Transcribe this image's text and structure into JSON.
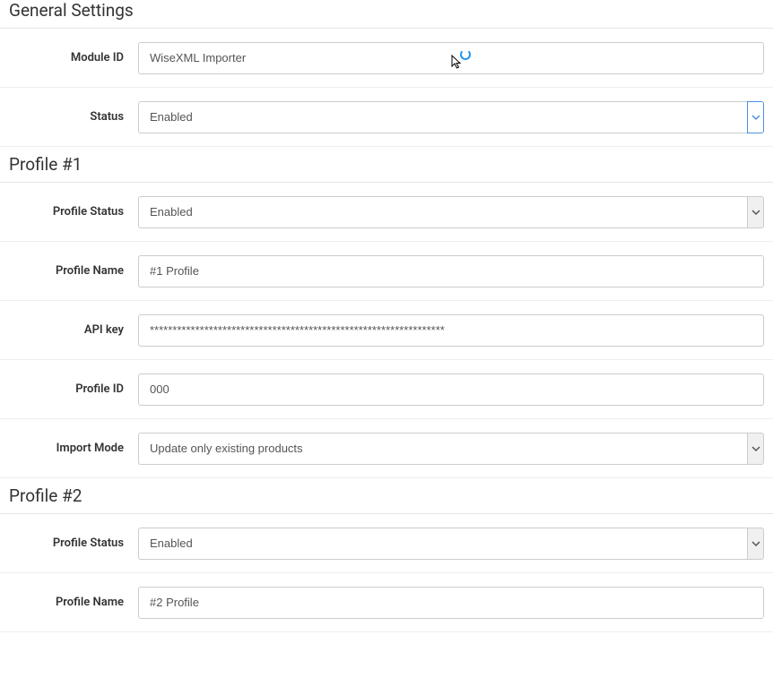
{
  "general": {
    "heading": "General Settings",
    "module_id_label": "Module ID",
    "module_id_value": "WiseXML Importer",
    "status_label": "Status",
    "status_value": "Enabled"
  },
  "profile1": {
    "heading": "Profile #1",
    "status_label": "Profile Status",
    "status_value": "Enabled",
    "name_label": "Profile Name",
    "name_value": "#1 Profile",
    "api_key_label": "API key",
    "api_key_value": "*****************************************************************",
    "id_label": "Profile ID",
    "id_value": "000",
    "import_mode_label": "Import Mode",
    "import_mode_value": "Update only existing products"
  },
  "profile2": {
    "heading": "Profile #2",
    "status_label": "Profile Status",
    "status_value": "Enabled",
    "name_label": "Profile Name",
    "name_value": "#2 Profile"
  }
}
